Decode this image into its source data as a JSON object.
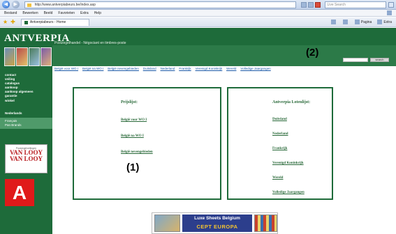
{
  "browser": {
    "url": "http://www.antverpiabeurs.be/index.asp",
    "search_placeholder": "Live Search",
    "menu": [
      "Bestand",
      "Bewerken",
      "Beeld",
      "Favorieten",
      "Extra",
      "Help"
    ],
    "tab_title": "Antverpiabeurs - Home",
    "tab_tools": [
      "Pagina",
      "Extra"
    ]
  },
  "site": {
    "logo": "ANTVERPIA",
    "tagline": "Postzegelhandel - Négociant en timbres-poste",
    "search_button": "search",
    "topnav": [
      "België voor WO I",
      "België na WO I",
      "België nevengebieden",
      "Duitsland",
      "Nederland",
      "Frankrijk",
      "Verenigd Koninkrijk",
      "Wereld",
      "Volledige Jaargangen"
    ],
    "sidebar_menu": [
      "contact",
      "veiling",
      "catalogus",
      "aankoop",
      "aankoop algemeen",
      "garantie",
      "winkel"
    ],
    "sidebar_lang": "Nederlands",
    "sidebar_lang_light": [
      "Français",
      "Pan Brands"
    ],
    "vanlooy_small": "Postzegelveilingen",
    "vanlooy_big1": "VAN LOOY",
    "vanlooy_big2": "VAN LOOY",
    "a_logo": "A"
  },
  "pricelist": {
    "title": "Prijslijst:",
    "links": [
      "België voor WO I",
      "België na WO I",
      "België nevengebieden"
    ]
  },
  "lotlist": {
    "title": "Antverpia Lotenlijst:",
    "links": [
      "Duitsland",
      "Nederland",
      "Frankrijk",
      "Verenigd Koninkrijk",
      "Wereld",
      "Volledige Jaargangen"
    ]
  },
  "banner": {
    "line1": "Luxe Sheets Belgium",
    "line2": "CEPT EUROPA"
  },
  "annotations": [
    "(1)",
    "(2)"
  ],
  "colors": {
    "site_green": "#1e6b3a",
    "link_blue": "#1e5ba8",
    "logo_red": "#e01a1a"
  }
}
